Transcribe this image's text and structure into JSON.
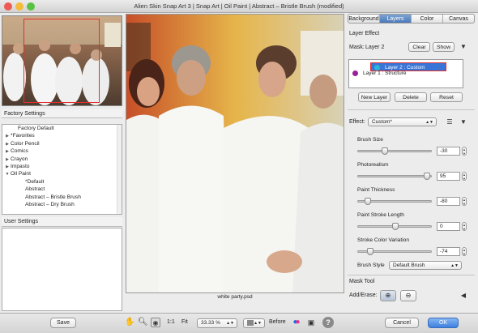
{
  "window": {
    "title": "Alien Skin Snap Art 3 | Snap Art | Oil Paint | Abstract – Bristle Brush (modified)"
  },
  "left": {
    "factory_header": "Factory Settings",
    "factory_items": [
      {
        "label": "Factory Default",
        "indent": 1,
        "arrow": ""
      },
      {
        "label": "*Favorites",
        "indent": 0,
        "arrow": "▶"
      },
      {
        "label": "Color Pencil",
        "indent": 0,
        "arrow": "▶"
      },
      {
        "label": "Comics",
        "indent": 0,
        "arrow": "▶"
      },
      {
        "label": "Crayon",
        "indent": 0,
        "arrow": "▶"
      },
      {
        "label": "Impasto",
        "indent": 0,
        "arrow": "▶"
      },
      {
        "label": "Oil Paint",
        "indent": 0,
        "arrow": "▼"
      },
      {
        "label": "*Default",
        "indent": 2,
        "arrow": ""
      },
      {
        "label": "Abstract",
        "indent": 2,
        "arrow": ""
      },
      {
        "label": "Abstract – Bristle Brush",
        "indent": 2,
        "arrow": ""
      },
      {
        "label": "Abstract – Dry Brush",
        "indent": 2,
        "arrow": ""
      }
    ],
    "user_header": "User Settings"
  },
  "canvas": {
    "filename": "white party.psd"
  },
  "tabs": [
    "Background",
    "Layers",
    "Color",
    "Canvas"
  ],
  "active_tab": "Layers",
  "layer_effect": {
    "header": "Layer Effect",
    "mask_label": "Mask:",
    "mask_value": "Layer 2",
    "clear": "Clear",
    "show": "Show",
    "layers": [
      {
        "name": "Layer 2 : Custom",
        "color": "#29b6d8",
        "selected": true
      },
      {
        "name": "Layer 1 : Structure",
        "color": "#9a1f9a",
        "selected": false
      }
    ],
    "new_layer": "New Layer",
    "delete": "Delete",
    "reset": "Reset"
  },
  "effect": {
    "label": "Effect:",
    "value": "Custom*"
  },
  "sliders": [
    {
      "label": "Brush Size",
      "value": "-30",
      "fraction": 0.35
    },
    {
      "label": "Photorealism",
      "value": "95",
      "fraction": 0.97
    },
    {
      "label": "Paint Thickness",
      "value": "-80",
      "fraction": 0.1
    },
    {
      "label": "Paint Stroke Length",
      "value": "0",
      "fraction": 0.5
    },
    {
      "label": "Stroke Color Variation",
      "value": "-74",
      "fraction": 0.13
    }
  ],
  "brush_style": {
    "label": "Brush Style",
    "value": "Default Brush"
  },
  "mask_tool": {
    "header": "Mask Tool",
    "label": "Add/Erase:"
  },
  "bottom": {
    "save": "Save",
    "zoom_1to1": "1:1",
    "fit": "Fit",
    "zoom": "33.33 %",
    "before": "Before",
    "cancel": "Cancel",
    "ok": "OK"
  },
  "colors": {
    "accent": "#3875d7",
    "selection_rect": "#e23030"
  }
}
